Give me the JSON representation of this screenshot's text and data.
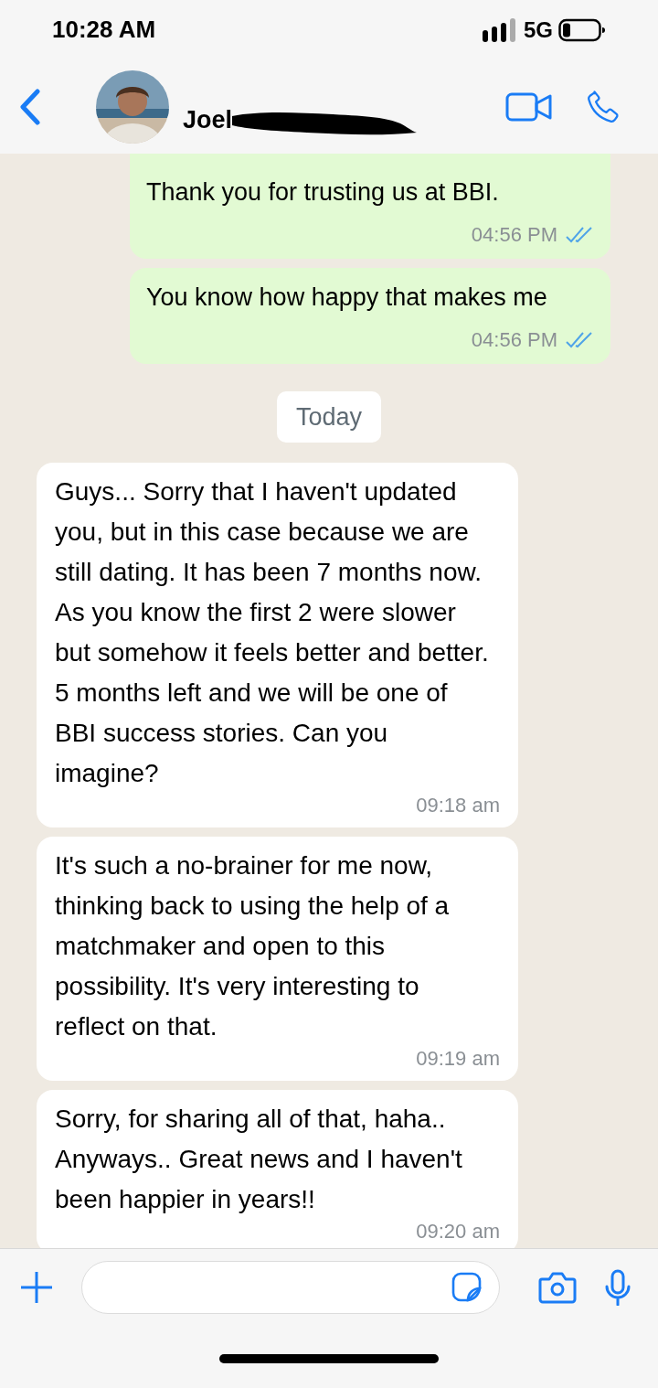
{
  "status_bar": {
    "time": "10:28 AM",
    "network": "5G"
  },
  "header": {
    "contact_name": "Joel",
    "name_redacted": true
  },
  "messages": [
    {
      "kind": "out",
      "text": "Thank you for trusting us at BBI.",
      "time": "04:56 PM",
      "read": true
    },
    {
      "kind": "out",
      "text": "You know how happy that makes me",
      "time": "04:56 PM",
      "read": true
    },
    {
      "kind": "date",
      "text": "Today"
    },
    {
      "kind": "in",
      "text": "Guys... Sorry that I haven't updated you, but in this case because we are still dating. It has been 7 months now. As you know the first 2 were slower but somehow it feels better and better. 5 months left and we will be one of BBI success stories. Can you imagine?",
      "time": "09:18 am"
    },
    {
      "kind": "in",
      "text": "It's such a no-brainer for me now, thinking back to using the help of a matchmaker and open to this possibility. It's very interesting to reflect on that.",
      "time": "09:19 am"
    },
    {
      "kind": "in",
      "text": "Sorry, for sharing all of that, haha.. Anyways.. Great news and I haven't been happier in years!!",
      "time": "09:20 am"
    }
  ]
}
